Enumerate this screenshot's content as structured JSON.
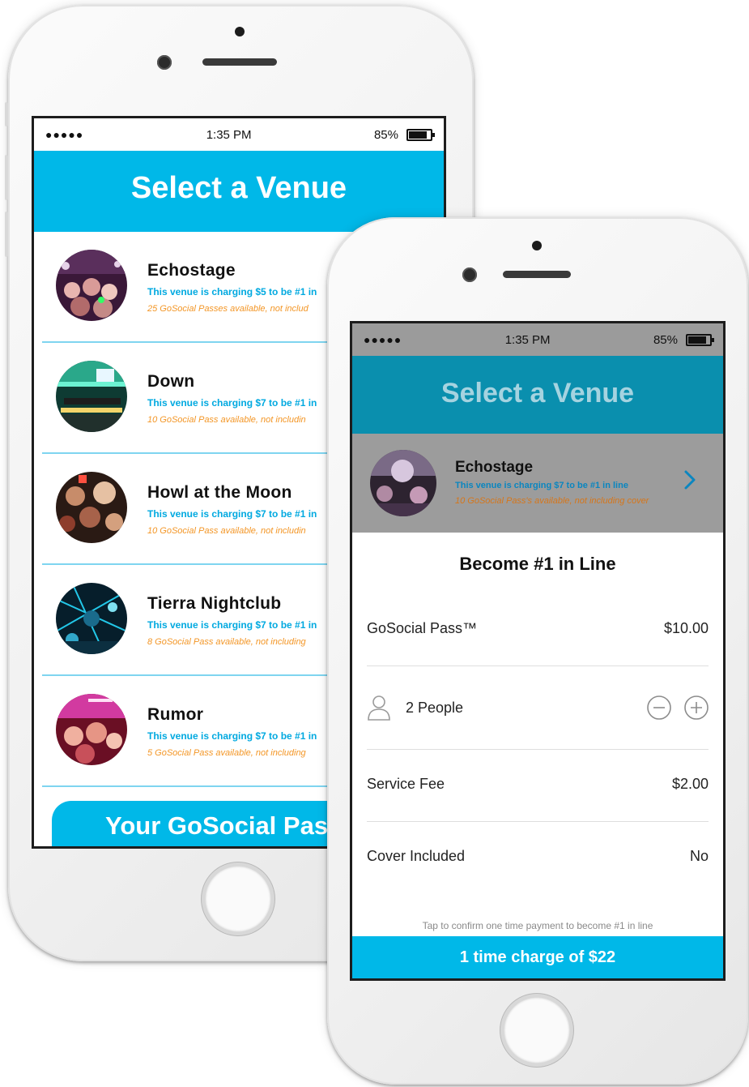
{
  "status_bar": {
    "signal": "●●●●●",
    "time": "1:35 PM",
    "battery": "85%"
  },
  "venue_list_screen": {
    "title": "Select a Venue",
    "venues": [
      {
        "name": "Echostage",
        "charge": "This venue is charging $5 to be #1 in",
        "availability": "25 GoSocial Passes available, not includ"
      },
      {
        "name": "Down",
        "charge": "This venue is charging $7 to be #1 in",
        "availability": "10 GoSocial Pass available, not includin"
      },
      {
        "name": "Howl at the Moon",
        "charge": "This venue is charging $7 to be #1 in",
        "availability": "10 GoSocial Pass available, not includin"
      },
      {
        "name": "Tierra Nightclub",
        "charge": "This venue is charging $7 to be #1 in",
        "availability": "8 GoSocial Pass available, not including"
      },
      {
        "name": "Rumor",
        "charge": "This venue is charging $7 to be #1 in",
        "availability": "5 GoSocial Pass available, not including"
      }
    ],
    "passes_button": "Your GoSocial Pas"
  },
  "checkout_screen": {
    "title": "Select a Venue",
    "selected_venue": {
      "name": "Echostage",
      "charge": "This venue is charging $7 to be #1 in line",
      "availability": "10 GoSocial Pass's available, not including cover"
    },
    "heading": "Become #1 in Line",
    "pass_label": "GoSocial Pass™",
    "pass_price": "$10.00",
    "people_label": "2 People",
    "fee_label": "Service Fee",
    "fee_value": "$2.00",
    "cover_label": "Cover Included",
    "cover_value": "No",
    "confirm_note": "Tap to confirm one time payment to become #1 in line",
    "charge_button": "1 time charge of $22"
  },
  "colors": {
    "accent": "#00b8e8",
    "charge_text": "#00a9e0",
    "availability_text": "#f39626"
  }
}
